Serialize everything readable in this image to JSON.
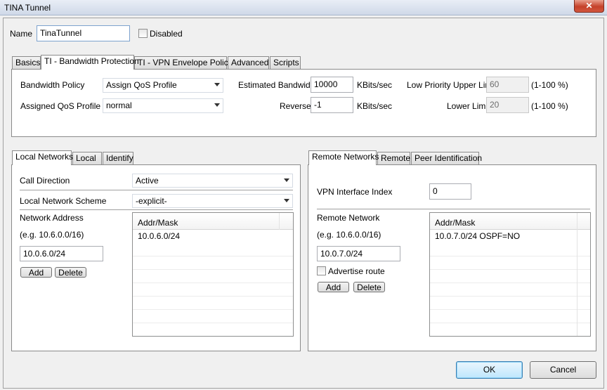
{
  "window": {
    "title": "TINA Tunnel",
    "close_glyph": "✕"
  },
  "name_row": {
    "label": "Name",
    "value": "TinaTunnel",
    "disabled_label": "Disabled",
    "disabled_checked": false
  },
  "top_tabs": [
    {
      "label": "Basics",
      "active": false
    },
    {
      "label": "TI - Bandwidth Protection",
      "active": true
    },
    {
      "label": "TI - VPN Envelope Policy",
      "active": false
    },
    {
      "label": "Advanced",
      "active": false
    },
    {
      "label": "Scripts",
      "active": false
    }
  ],
  "bandwidth": {
    "policy_label": "Bandwidth Policy",
    "policy_value": "Assign QoS Profile",
    "qos_label": "Assigned QoS Profile",
    "qos_value": "normal",
    "est_label": "Estimated Bandwidth",
    "est_value": "10000",
    "est_unit": "KBits/sec",
    "reverse_label": "Reverse",
    "reverse_value": "-1",
    "reverse_unit": "KBits/sec",
    "low_upper_label": "Low Priority Upper Limit",
    "low_upper_value": "60",
    "low_upper_range": "(1-100 %)",
    "lower_label": "Lower Limit",
    "lower_value": "20",
    "lower_range": "(1-100 %)"
  },
  "local_tabs": [
    {
      "label": "Local Networks",
      "active": true
    },
    {
      "label": "Local",
      "active": false
    },
    {
      "label": "Identify",
      "active": false
    }
  ],
  "local": {
    "call_direction_label": "Call Direction",
    "call_direction_value": "Active",
    "scheme_label": "Local Network Scheme",
    "scheme_value": "-explicit-",
    "network_address_label": "Network Address",
    "example": "(e.g. 10.6.0.0/16)",
    "input_value": "10.0.6.0/24",
    "add_label": "Add",
    "delete_label": "Delete",
    "list_header": "Addr/Mask",
    "list_items": [
      "10.0.6.0/24"
    ]
  },
  "remote_tabs": [
    {
      "label": "Remote Networks",
      "active": true
    },
    {
      "label": "Remote",
      "active": false
    },
    {
      "label": "Peer Identification",
      "active": false
    }
  ],
  "remote": {
    "vpn_index_label": "VPN Interface Index",
    "vpn_index_value": "0",
    "remote_network_label": "Remote Network",
    "example": "(e.g. 10.6.0.0/16)",
    "input_value": "10.0.7.0/24",
    "advertise_label": "Advertise route",
    "advertise_checked": false,
    "add_label": "Add",
    "delete_label": "Delete",
    "list_header": "Addr/Mask",
    "list_items": [
      "10.0.7.0/24 OSPF=NO"
    ]
  },
  "footer": {
    "ok_label": "OK",
    "cancel_label": "Cancel"
  }
}
